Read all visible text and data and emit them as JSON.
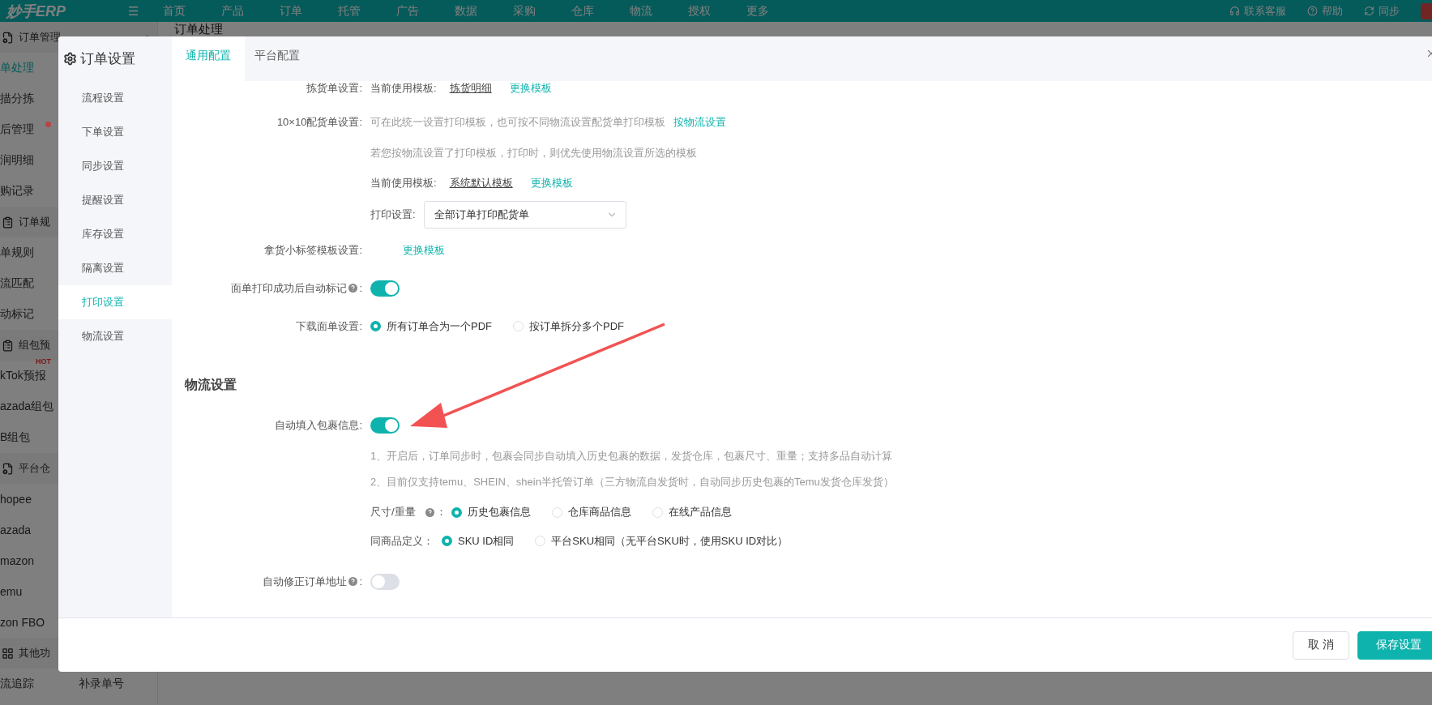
{
  "top_bar": {
    "logo": "妙手ERP",
    "menu_glyph": "☰",
    "nav": [
      "首页",
      "产品",
      "订单",
      "托管",
      "广告",
      "数据",
      "采购",
      "仓库",
      "物流",
      "授权",
      "更多"
    ],
    "actions": [
      "联系客服",
      "帮助",
      "同步"
    ]
  },
  "sidebar": {
    "sections": [
      {
        "title": "订单管理",
        "expanded": true,
        "items": [
          {
            "label": "单处理",
            "selected": true
          },
          {
            "label": "描分拣",
            "selected": false
          },
          {
            "label": "后管理",
            "selected": false,
            "color": "#b84444"
          },
          {
            "label": "润明细",
            "selected": false
          },
          {
            "label": "购记录",
            "selected": false
          }
        ]
      },
      {
        "title": "订单规",
        "items": [
          {
            "label": "单规则",
            "selected": false
          },
          {
            "label": "流匹配",
            "selected": false
          },
          {
            "label": "动标记",
            "selected": false
          }
        ]
      },
      {
        "title": "组包预",
        "items": [
          {
            "label": "kTok预报",
            "selected": false,
            "badge": "HOT"
          },
          {
            "label": "azada组包",
            "selected": false
          },
          {
            "label": "B组包",
            "selected": false
          }
        ]
      },
      {
        "title": "平台仓",
        "items": [
          {
            "label": "hopee",
            "selected": false
          },
          {
            "label": "azada",
            "selected": false
          },
          {
            "label": "mazon",
            "selected": false
          },
          {
            "label": "emu",
            "selected": false
          },
          {
            "label": "zon FBO",
            "selected": false
          }
        ]
      },
      {
        "title": "其他功",
        "items": [
          {
            "label": "流追踪",
            "selected": false
          }
        ],
        "side_items": [
          {
            "label": "补录单号",
            "selected": false
          }
        ]
      }
    ]
  },
  "page_title": "订单处理",
  "dialog": {
    "title": "订单设置",
    "nav": [
      {
        "label": "流程设置",
        "selected": false
      },
      {
        "label": "下单设置",
        "selected": false
      },
      {
        "label": "同步设置",
        "selected": false
      },
      {
        "label": "提醒设置",
        "selected": false
      },
      {
        "label": "库存设置",
        "selected": false
      },
      {
        "label": "隔离设置",
        "selected": false
      },
      {
        "label": "打印设置",
        "selected": true
      },
      {
        "label": "物流设置",
        "selected": false
      }
    ],
    "tabs": [
      {
        "label": "通用配置",
        "selected": true
      },
      {
        "label": "平台配置",
        "selected": false
      }
    ],
    "settings": [
      {
        "kind": "template",
        "label": "拣货单设置:",
        "prefix": "当前使用模板:",
        "template": "拣货明细",
        "link": "更换模板"
      },
      {
        "kind": "note",
        "label": "10×10配货单设置:",
        "text": "可在此统一设置打印模板，也可按不同物流设置配货单打印模板",
        "link": "按物流设置"
      },
      {
        "kind": "note",
        "text": "若您按物流设置了打印模板，打印时，则优先使用物流设置所选的模板"
      },
      {
        "kind": "template",
        "prefix": "当前使用模板:",
        "template": "系统默认模板",
        "link": "更换模板"
      },
      {
        "kind": "select",
        "prefix": "打印设置:",
        "value": "全部订单打印配货单"
      },
      {
        "kind": "link",
        "label": "拿货小标签模板设置:",
        "link": "更换模板"
      },
      {
        "kind": "toggle",
        "label": "面单打印成功后自动标记",
        "help": true,
        "colon": ":",
        "on": true
      },
      {
        "kind": "radios",
        "label": "下载面单设置:",
        "options": [
          {
            "label": "所有订单合为一个PDF",
            "selected": true
          },
          {
            "label": "按订单拆分多个PDF",
            "selected": false
          }
        ]
      },
      {
        "kind": "section",
        "title": "物流设置"
      },
      {
        "kind": "toggle",
        "label": "自动填入包裹信息:",
        "on": true
      },
      {
        "kind": "note",
        "text": "1、开启后，订单同步时，包裹会同步自动填入历史包裹的数据，发货仓库，包裹尺寸、重量；支持多品自动计算"
      },
      {
        "kind": "note",
        "text": "2、目前仅支持temu、SHEIN、shein半托管订单（三方物流自发货时，自动同步历史包裹的Temu发货仓库发货）"
      },
      {
        "kind": "radios",
        "prefix": "尺寸/重量",
        "help": true,
        "colon": "：",
        "options": [
          {
            "label": "历史包裹信息",
            "selected": true
          },
          {
            "label": "仓库商品信息",
            "selected": false
          },
          {
            "label": "在线产品信息",
            "selected": false
          }
        ]
      },
      {
        "kind": "radios",
        "prefix": "同商品定义：",
        "options": [
          {
            "label": "SKU ID相同",
            "selected": true
          },
          {
            "label": "平台SKU相同（无平台SKU时，使用SKU ID对比）",
            "selected": false
          }
        ]
      },
      {
        "kind": "toggle",
        "label": "自动修正订单地址",
        "help": true,
        "colon": ":",
        "on": false
      }
    ],
    "buttons": [
      {
        "label": "取 消",
        "kind": "secondary"
      },
      {
        "label": "保存设置",
        "kind": "primary"
      }
    ]
  }
}
